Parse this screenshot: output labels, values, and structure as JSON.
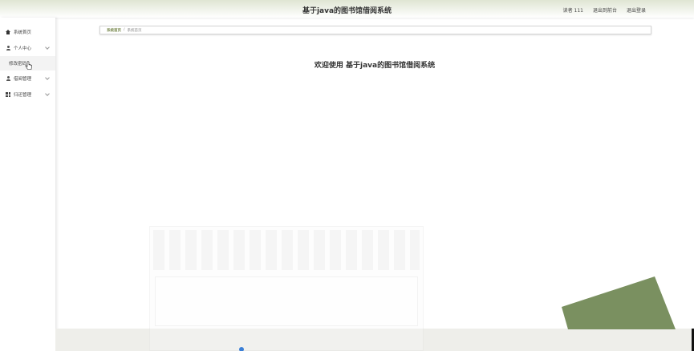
{
  "header": {
    "app_title": "基于java的图书馆借阅系统",
    "links": [
      "读者 111",
      "退出到前台",
      "退出登录"
    ]
  },
  "sidebar": {
    "items": [
      {
        "label": "系统首页",
        "icon": "home-icon"
      },
      {
        "label": "个人中心",
        "icon": "user-icon",
        "sub": [
          "修改密码"
        ]
      },
      {
        "label": "借阅管理",
        "icon": "user-icon"
      },
      {
        "label": "归还管理",
        "icon": "grid-icon"
      }
    ]
  },
  "breadcrumb": {
    "home": "系统首页",
    "separator": "/",
    "current": "系统首页"
  },
  "main": {
    "welcome": "欢迎使用 基于java的图书馆借阅系统"
  },
  "colors": {
    "accent": "#7a8a50",
    "shape": "#7a9060"
  }
}
